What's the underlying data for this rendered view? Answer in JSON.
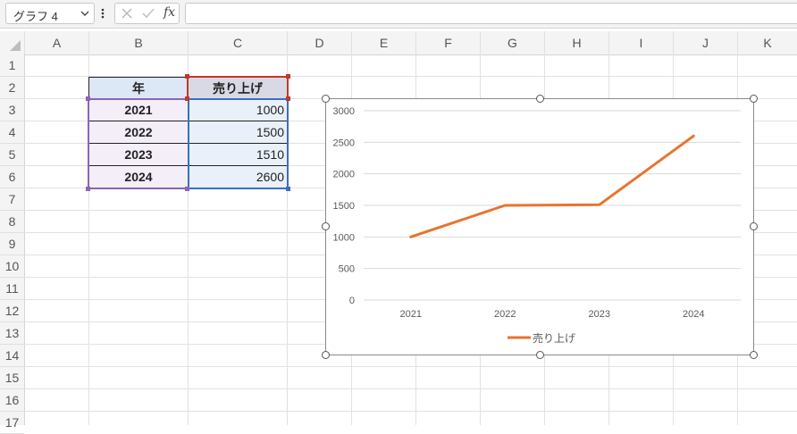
{
  "formula_bar": {
    "name_box": "グラフ 4",
    "fx": "fx",
    "value": ""
  },
  "columns": [
    "A",
    "B",
    "C",
    "D",
    "E",
    "F",
    "G",
    "H",
    "I",
    "J",
    "K"
  ],
  "rows": [
    "1",
    "2",
    "3",
    "4",
    "5",
    "6",
    "7",
    "8",
    "9",
    "10",
    "11",
    "12",
    "13",
    "14",
    "15",
    "16",
    "17"
  ],
  "table": {
    "header_year": "年",
    "header_sales": "売り上げ",
    "rows": [
      {
        "year": "2021",
        "sales": "1000"
      },
      {
        "year": "2022",
        "sales": "1500"
      },
      {
        "year": "2023",
        "sales": "1510"
      },
      {
        "year": "2024",
        "sales": "2600"
      }
    ]
  },
  "colors": {
    "series": "#e8742e",
    "year_range_border": "#8e63b9",
    "sales_range_border": "#3b6fbf",
    "header_range_border": "#c0392b"
  },
  "chart_data": {
    "type": "line",
    "categories": [
      "2021",
      "2022",
      "2023",
      "2024"
    ],
    "series": [
      {
        "name": "売り上げ",
        "values": [
          1000,
          1500,
          1510,
          2600
        ]
      }
    ],
    "title": "",
    "xlabel": "",
    "ylabel": "",
    "ylim": [
      0,
      3000
    ],
    "yticks": [
      "0",
      "500",
      "1000",
      "1500",
      "2000",
      "2500",
      "3000"
    ],
    "grid": "horizontal",
    "legend_position": "bottom"
  }
}
